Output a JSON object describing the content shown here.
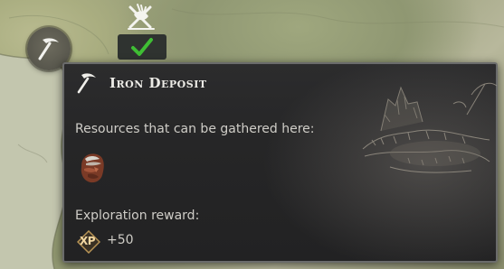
{
  "map": {
    "location_marker_icon": "pickaxe-icon",
    "unit_icon": "scout-unit-icon",
    "status_icon": "checkmark-icon",
    "status_color": "#3fbe34"
  },
  "tooltip": {
    "header_icon": "pickaxe-icon",
    "title": "Iron Deposit",
    "resources_label": "Resources that can be gathered here:",
    "resources": [
      {
        "icon": "iron-ore-icon"
      }
    ],
    "reward_label": "Exploration reward:",
    "reward_badge": "XP",
    "reward_value": "+50",
    "illustration": "iron-deposit-sketch"
  },
  "colors": {
    "panel_bg": "#262627",
    "panel_border": "#6a6b6b",
    "title_text": "#ecebe6",
    "body_text": "#cfcdc7",
    "xp_gold": "#f3d8a2"
  }
}
